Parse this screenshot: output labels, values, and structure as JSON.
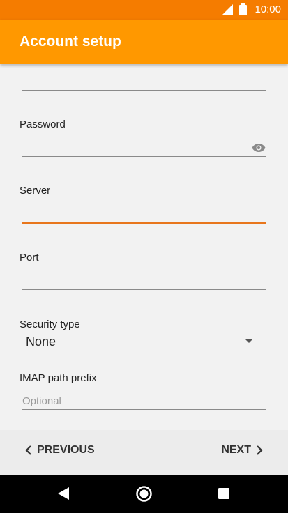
{
  "status_bar": {
    "time": "10:00",
    "signal_icon": "signal-icon",
    "battery_icon": "battery-icon"
  },
  "app_bar": {
    "title": "Account setup"
  },
  "form": {
    "password": {
      "label": "Password",
      "value": "",
      "toggle_icon": "eye-icon"
    },
    "server": {
      "label": "Server",
      "value": ""
    },
    "port": {
      "label": "Port",
      "value": ""
    },
    "security_type": {
      "label": "Security type",
      "value": "None"
    },
    "imap_path_prefix": {
      "label": "IMAP path prefix",
      "placeholder": "Optional"
    }
  },
  "footer": {
    "previous_label": "PREVIOUS",
    "next_label": "NEXT"
  },
  "nav": {
    "back_icon": "back-icon",
    "home_icon": "home-icon",
    "recents_icon": "recents-icon"
  },
  "colors": {
    "status_bar": "#f57c00",
    "app_bar": "#ff9800",
    "accent": "#e8761c"
  }
}
